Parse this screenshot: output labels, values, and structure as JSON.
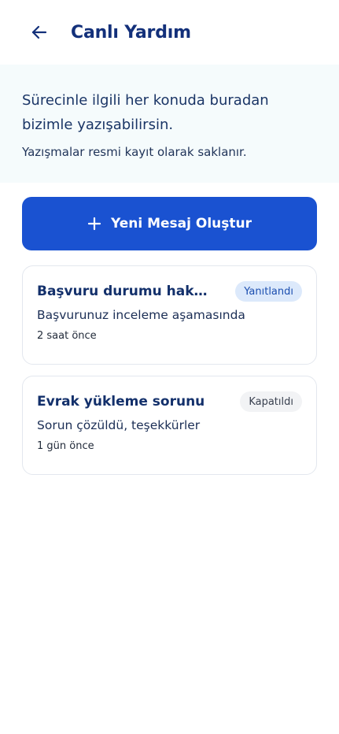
{
  "header": {
    "back_icon": "arrow-left-icon",
    "title": "Canlı Yardım"
  },
  "info": {
    "main_text": "Sürecinle ilgili her konuda buradan bizimle yazışabilirsin.",
    "sub_text": "Yazışmalar resmi kayıt olarak saklanır."
  },
  "new_message": {
    "icon": "plus-icon",
    "label": "Yeni Mesaj Oluştur"
  },
  "conversations": [
    {
      "title": "Başvuru durumu hakkında",
      "status": "Yanıtlandı",
      "preview": "Başvurunuz inceleme aşamasında",
      "time": "2 saat önce"
    },
    {
      "title": "Evrak yükleme sorunu",
      "status": "Kapatıldı",
      "preview": "Sorun çözüldü, teşekkürler",
      "time": "1 gün önce"
    }
  ],
  "colors": {
    "primary": "#1a52d1",
    "title": "#13307a",
    "banner_bg": "#f5fbfc",
    "badge_answered_bg": "#dce9fb",
    "badge_closed_bg": "#f2f3f5"
  }
}
